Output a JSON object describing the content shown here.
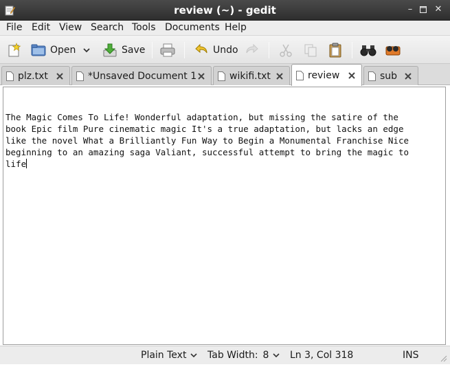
{
  "window": {
    "title": "review (~) - gedit"
  },
  "menu": [
    "File",
    "Edit",
    "View",
    "Search",
    "Tools",
    "Documents",
    "Help"
  ],
  "toolbar": {
    "open_label": "Open",
    "save_label": "Save",
    "undo_label": "Undo"
  },
  "tabs": [
    {
      "label": "plz.txt"
    },
    {
      "label": "*Unsaved Document 1"
    },
    {
      "label": "wikifi.txt"
    },
    {
      "label": "review",
      "active": true
    },
    {
      "label": "sub"
    }
  ],
  "editor": {
    "lines": [
      "",
      "",
      "The Magic Comes To Life! Wonderful adaptation, but missing the satire of the",
      "book Epic film Pure cinematic magic It's a true adaptation, but lacks an edge",
      "like the novel What a Brilliantly Fun Way to Begin a Monumental Franchise Nice",
      "beginning to an amazing saga Valiant, successful attempt to bring the magic to",
      "life"
    ]
  },
  "status": {
    "language": "Plain Text",
    "tab_width_label": "Tab Width:",
    "tab_width_value": "8",
    "position": "Ln 3, Col 318",
    "mode": "INS"
  },
  "colors": {
    "titlebar": "#3a3a3a",
    "accent": "#e7a33a"
  }
}
